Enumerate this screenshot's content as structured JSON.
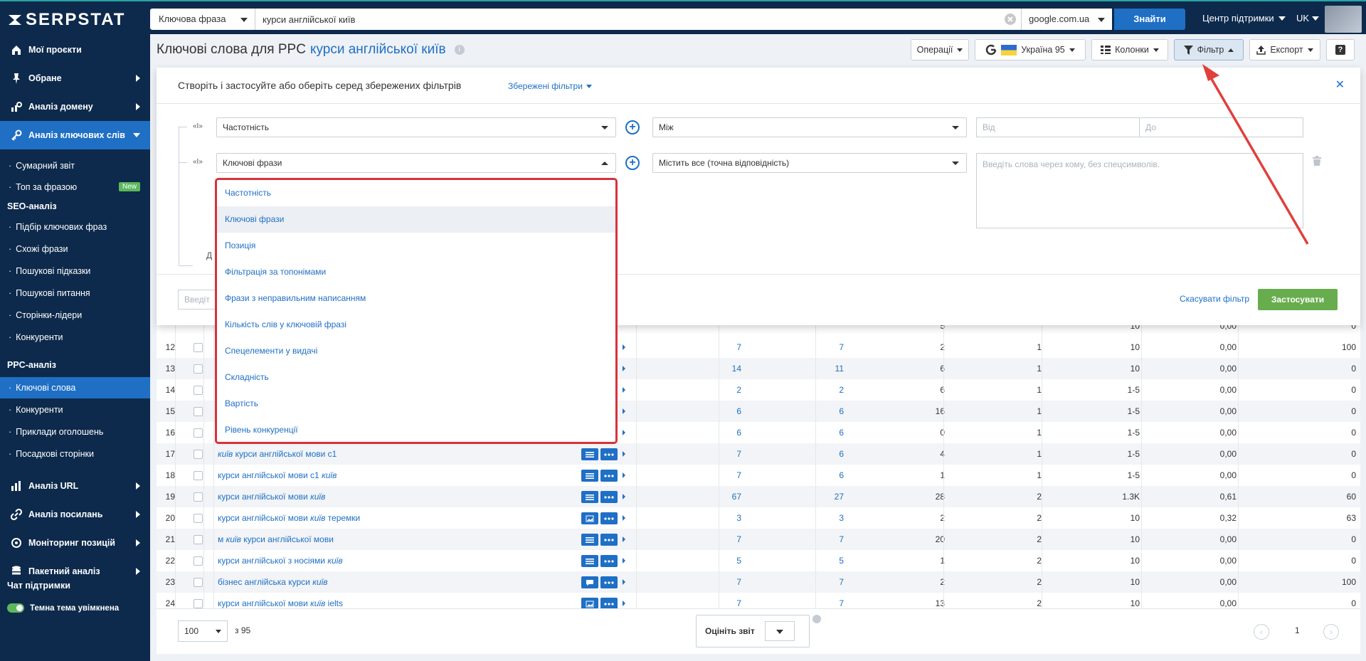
{
  "app": {
    "logo_text": "SERPSTAT"
  },
  "topbar": {
    "search_type": "Ключова фраза",
    "search_query": "курси англійської київ",
    "engine": "google.com.ua",
    "find_label": "Знайти",
    "support_label": "Центр підтримки",
    "lang": "UK"
  },
  "sidebar": {
    "main": [
      {
        "label": "Мої проєкти",
        "icon": "home-icon"
      },
      {
        "label": "Обране",
        "icon": "pin-icon"
      },
      {
        "label": "Аналіз домену",
        "icon": "domain-analysis-icon"
      },
      {
        "label": "Аналіз ключових слів",
        "icon": "key-icon"
      }
    ],
    "keyword_items": [
      {
        "label": "Сумарний звіт"
      },
      {
        "label": "Топ за фразою",
        "badge": "New"
      }
    ],
    "seo_header": "SEO-аналіз",
    "seo_items": [
      "Підбір ключових фраз",
      "Схожі фрази",
      "Пошукові підказки",
      "Пошукові питання",
      "Сторінки-лідери",
      "Конкуренти"
    ],
    "ppc_header": "PPC-аналіз",
    "ppc_items": [
      "Ключові слова",
      "Конкуренти",
      "Приклади оголошень",
      "Посадкові сторінки"
    ],
    "bottom_main": [
      {
        "label": "Аналіз URL",
        "icon": "chart-bar-icon"
      },
      {
        "label": "Аналіз посилань",
        "icon": "link-icon"
      },
      {
        "label": "Моніторинг позицій",
        "icon": "monitor-icon"
      },
      {
        "label": "Пакетний аналіз",
        "icon": "database-icon"
      }
    ],
    "chat_support": "Чат підтримки",
    "theme_label": "Темна тема увімкнена"
  },
  "page": {
    "title_prefix": "Ключові слова для PPC",
    "title_query": "курси англійської київ"
  },
  "toolbar": {
    "operations": "Операції",
    "region": "Україна 95",
    "columns": "Колонки",
    "filter": "Фільтр",
    "export": "Експорт",
    "help": "?"
  },
  "filter_panel": {
    "title": "Створіть і застосуйте або оберіть серед збережених фільтрів",
    "saved_filters": "Збережені фільтри",
    "and_label": "«І»",
    "row1": {
      "field": "Частотність",
      "condition": "Між",
      "from_placeholder": "Від",
      "to_placeholder": "До"
    },
    "row2": {
      "field": "Ключові фрази",
      "condition": "Містить все (точна відповідність)",
      "placeholder": "Введіть слова через кому, без спецсимволів."
    },
    "add_label_partial": "Д",
    "bottom_input_partial": "Введіт",
    "cancel_label": "Скасувати фільтр",
    "apply_label": "Застосувати"
  },
  "dropdown": {
    "items": [
      "Частотність",
      "Ключові фрази",
      "Позиція",
      "Фільтрація за топонімами",
      "Фрази з неправильним написанням",
      "Кількість слів у ключовій фразі",
      "Спецелементи у видачі",
      "Складність",
      "Вартість",
      "Рівень конкуренції"
    ],
    "highlighted": "Ключові фрази"
  },
  "table": {
    "partial_top": {
      "c3": "5",
      "c5": "10",
      "c6": "0,00",
      "c7": "0"
    },
    "rows": [
      {
        "n": "12",
        "kw": [],
        "c1": "7",
        "c2": "7",
        "c3": "2",
        "c4": "1",
        "c5": "10",
        "c6": "0,00",
        "c7": "100",
        "icon": "list"
      },
      {
        "n": "13",
        "kw": [],
        "c1": "14",
        "c2": "11",
        "c3": "6",
        "c4": "1",
        "c5": "10",
        "c6": "0,00",
        "c7": "0",
        "icon": "list"
      },
      {
        "n": "14",
        "kw": [],
        "c1": "2",
        "c2": "2",
        "c3": "6",
        "c4": "1",
        "c5": "1-5",
        "c6": "0,00",
        "c7": "0",
        "icon": "list"
      },
      {
        "n": "15",
        "kw": [],
        "c1": "6",
        "c2": "6",
        "c3": "16",
        "c4": "1",
        "c5": "1-5",
        "c6": "0,00",
        "c7": "0",
        "icon": "list"
      },
      {
        "n": "16",
        "kw": [],
        "c1": "6",
        "c2": "6",
        "c3": "0",
        "c4": "1",
        "c5": "1-5",
        "c6": "0,00",
        "c7": "0",
        "icon": "list"
      },
      {
        "n": "17",
        "kw": [
          {
            "t": "київ",
            "i": true
          },
          {
            "t": " курси англійської мови с1",
            "i": false
          }
        ],
        "c1": "7",
        "c2": "6",
        "c3": "4",
        "c4": "1",
        "c5": "1-5",
        "c6": "0,00",
        "c7": "0",
        "icon": "list"
      },
      {
        "n": "18",
        "kw": [
          {
            "t": "курси англійської мови с1 ",
            "i": false
          },
          {
            "t": "київ",
            "i": true
          }
        ],
        "c1": "7",
        "c2": "6",
        "c3": "1",
        "c4": "1",
        "c5": "1-5",
        "c6": "0,00",
        "c7": "0",
        "icon": "list"
      },
      {
        "n": "19",
        "kw": [
          {
            "t": "курси англійської мови ",
            "i": false
          },
          {
            "t": "київ",
            "i": true
          }
        ],
        "c1": "67",
        "c2": "27",
        "c3": "28",
        "c4": "2",
        "c5": "1.3K",
        "c6": "0,61",
        "c7": "60",
        "icon": "list"
      },
      {
        "n": "20",
        "kw": [
          {
            "t": "курси англійської мови ",
            "i": false
          },
          {
            "t": "київ",
            "i": true
          },
          {
            "t": " теремки",
            "i": false
          }
        ],
        "c1": "3",
        "c2": "3",
        "c3": "2",
        "c4": "2",
        "c5": "10",
        "c6": "0,32",
        "c7": "63",
        "icon": "image"
      },
      {
        "n": "21",
        "kw": [
          {
            "t": "м ",
            "i": false
          },
          {
            "t": "київ",
            "i": true
          },
          {
            "t": " курси англійської мови",
            "i": false
          }
        ],
        "c1": "7",
        "c2": "7",
        "c3": "20",
        "c4": "2",
        "c5": "10",
        "c6": "0,00",
        "c7": "0",
        "icon": "list"
      },
      {
        "n": "22",
        "kw": [
          {
            "t": "курси англійської з носіями ",
            "i": false
          },
          {
            "t": "київ",
            "i": true
          }
        ],
        "c1": "5",
        "c2": "5",
        "c3": "1",
        "c4": "2",
        "c5": "10",
        "c6": "0,00",
        "c7": "0",
        "icon": "list"
      },
      {
        "n": "23",
        "kw": [
          {
            "t": "бізнес англійська курси ",
            "i": false
          },
          {
            "t": "київ",
            "i": true
          }
        ],
        "c1": "7",
        "c2": "7",
        "c3": "2",
        "c4": "2",
        "c5": "10",
        "c6": "0,00",
        "c7": "100",
        "icon": "chat"
      },
      {
        "n": "24",
        "kw": [
          {
            "t": "курси англійської мови ",
            "i": false
          },
          {
            "t": "київ",
            "i": true
          },
          {
            "t": " ielts",
            "i": false
          }
        ],
        "c1": "7",
        "c2": "7",
        "c3": "13",
        "c4": "2",
        "c5": "10",
        "c6": "0,00",
        "c7": "0",
        "icon": "image"
      }
    ]
  },
  "footer": {
    "per_page": "100",
    "of_total": "з 95",
    "rate_label": "Оцініть звіт",
    "page": "1"
  },
  "colors": {
    "brand_dark": "#0d2a4c",
    "accent_blue": "#1f6fc5",
    "apply_green": "#68ad4d",
    "highlight_red": "#d8323c"
  }
}
